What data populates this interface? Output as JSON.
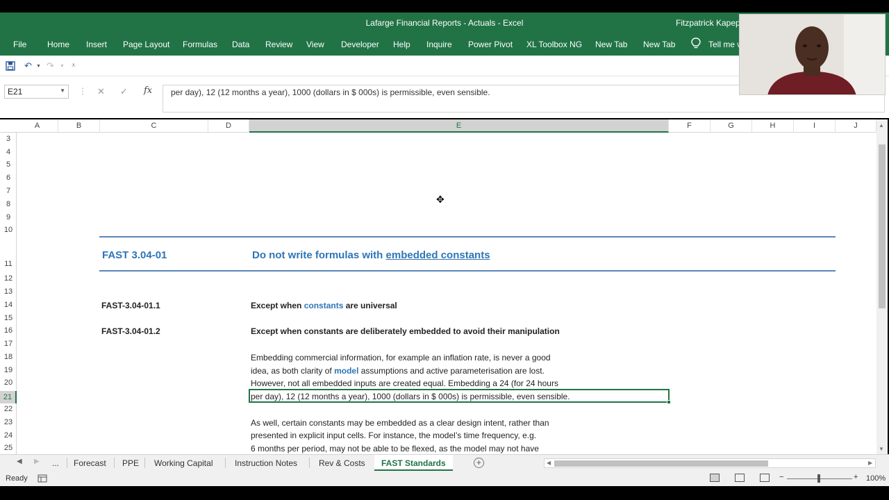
{
  "window": {
    "title": "Lafarge Financial Reports - Actuals  -  Excel",
    "user": "Fitzpatrick Kapepe"
  },
  "ribbon": {
    "tabs": [
      "File",
      "Home",
      "Insert",
      "Page Layout",
      "Formulas",
      "Data",
      "Review",
      "View",
      "Developer",
      "Help",
      "Inquire",
      "Power Pivot",
      "XL Toolbox NG",
      "New Tab",
      "New Tab"
    ],
    "tell_me": "Tell me w",
    "accent_color": "#217346"
  },
  "quick_access": {
    "icons": [
      "save-icon",
      "undo-icon",
      "redo-icon",
      "customize-icon"
    ]
  },
  "formula_bar": {
    "name_box": "E21",
    "fx": "fx",
    "content": "per day), 12 (12 months a year), 1000 (dollars in $ 000s) is permissible, even sensible."
  },
  "columns": [
    "A",
    "B",
    "C",
    "D",
    "E",
    "F",
    "G",
    "H",
    "I",
    "J"
  ],
  "rows": [
    "3",
    "4",
    "5",
    "6",
    "7",
    "8",
    "9",
    "10",
    "11",
    "12",
    "13",
    "14",
    "15",
    "16",
    "17",
    "18",
    "19",
    "20",
    "21",
    "22",
    "23",
    "24",
    "25"
  ],
  "selected": {
    "column": "E",
    "row": "21"
  },
  "content": {
    "rule_id": "FAST 3.04-01",
    "rule_title_pre": "Do not write formulas with ",
    "rule_title_link": "embedded constants",
    "sub1_id": "FAST-3.04-01.1",
    "sub1_pre": "Except when ",
    "sub1_link": "constants",
    "sub1_post": " are universal",
    "sub2_id": "FAST-3.04-01.2",
    "sub2_text": "Except when constants are deliberately embedded to avoid their manipulation",
    "p1_l1": "Embedding commercial information, for example an inflation rate, is never a good",
    "p1_l2_pre": "idea, as both clarity of ",
    "p1_l2_link": "model",
    "p1_l2_post": " assumptions and active parameterisation are lost.",
    "p1_l3": "However, not all embedded inputs are created equal. Embedding a 24 (for 24 hours",
    "p1_l4": "per day), 12 (12 months a year), 1000 (dollars in $ 000s) is permissible, even sensible.",
    "p2_l1": "As well, certain constants may be embedded as a clear design intent, rather than",
    "p2_l2": "presented in explicit input cells. For instance, the model’s time frequency, e.g.",
    "p2_l3": "6 months per period, may not be able to be flexed, as the model may not have"
  },
  "sheets": {
    "ellipsis": "...",
    "tabs": [
      "Forecast",
      "PPE",
      "Working Capital",
      "Instruction Notes",
      "Rev & Costs",
      "FAST Standards"
    ],
    "active": "FAST Standards"
  },
  "status": {
    "ready": "Ready",
    "zoom": "100%"
  }
}
